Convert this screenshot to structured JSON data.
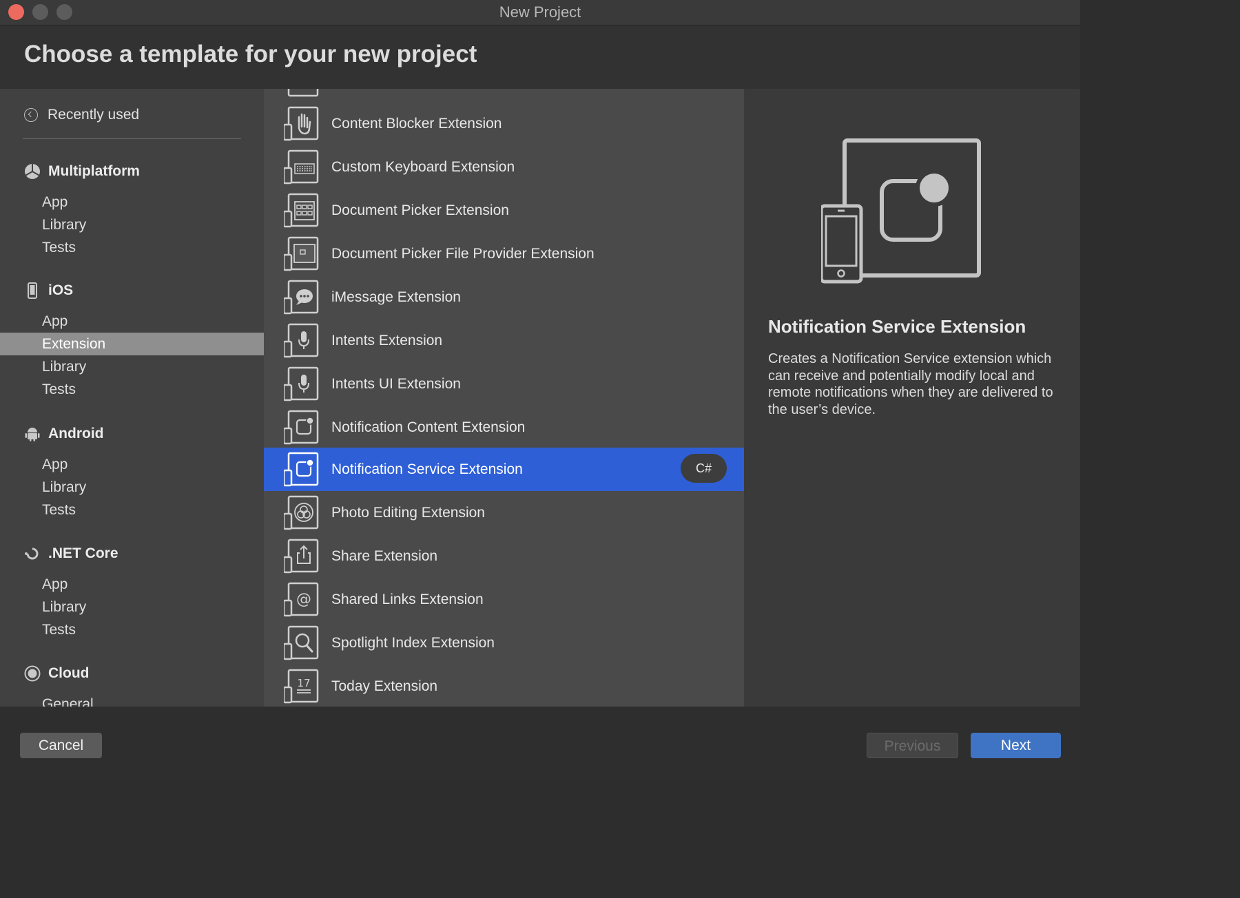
{
  "window": {
    "title": "New Project"
  },
  "header": {
    "title": "Choose a template for your new project"
  },
  "sidebar": {
    "recent": {
      "label": "Recently used",
      "icon": "clock-back-icon"
    },
    "sections": [
      {
        "title": "Multiplatform",
        "icon": "multiplatform-icon",
        "items": [
          "App",
          "Library",
          "Tests"
        ]
      },
      {
        "title": "iOS",
        "icon": "phone-icon",
        "items": [
          "App",
          "Extension",
          "Library",
          "Tests"
        ],
        "selected": "Extension"
      },
      {
        "title": "Android",
        "icon": "android-icon",
        "items": [
          "App",
          "Library",
          "Tests"
        ]
      },
      {
        "title": ".NET Core",
        "icon": "dotnet-icon",
        "items": [
          "App",
          "Library",
          "Tests"
        ]
      },
      {
        "title": "Cloud",
        "icon": "cloud-icon",
        "items": [
          "General"
        ]
      }
    ]
  },
  "templates": [
    {
      "label": "Content Blocker Extension",
      "icon": "hand-icon"
    },
    {
      "label": "Custom Keyboard Extension",
      "icon": "keyboard-icon"
    },
    {
      "label": "Document Picker Extension",
      "icon": "document-grid-icon"
    },
    {
      "label": "Document Picker File Provider Extension",
      "icon": "folder-icon"
    },
    {
      "label": "iMessage Extension",
      "icon": "message-bubble-icon"
    },
    {
      "label": "Intents Extension",
      "icon": "microphone-icon"
    },
    {
      "label": "Intents UI Extension",
      "icon": "microphone-icon"
    },
    {
      "label": "Notification Content Extension",
      "icon": "notification-icon"
    },
    {
      "label": "Notification Service Extension",
      "icon": "notification-icon",
      "selected": true,
      "badge": "C#"
    },
    {
      "label": "Photo Editing Extension",
      "icon": "photo-filters-icon"
    },
    {
      "label": "Share Extension",
      "icon": "share-icon"
    },
    {
      "label": "Shared Links Extension",
      "icon": "at-sign-icon"
    },
    {
      "label": "Spotlight Index Extension",
      "icon": "magnifier-icon"
    },
    {
      "label": "Today Extension",
      "icon": "calendar-17-icon",
      "day": "17"
    }
  ],
  "detail": {
    "title": "Notification Service Extension",
    "description": "Creates a Notification Service extension which can receive and potentially modify local and remote notifications when they are delivered to the user’s device.",
    "icon": "notification-extension-icon"
  },
  "footer": {
    "cancel_label": "Cancel",
    "previous_label": "Previous",
    "next_label": "Next"
  },
  "colors": {
    "selection": "#2e5fd6",
    "next_button": "#3f74c4",
    "close_button": "#ed6a5e"
  }
}
